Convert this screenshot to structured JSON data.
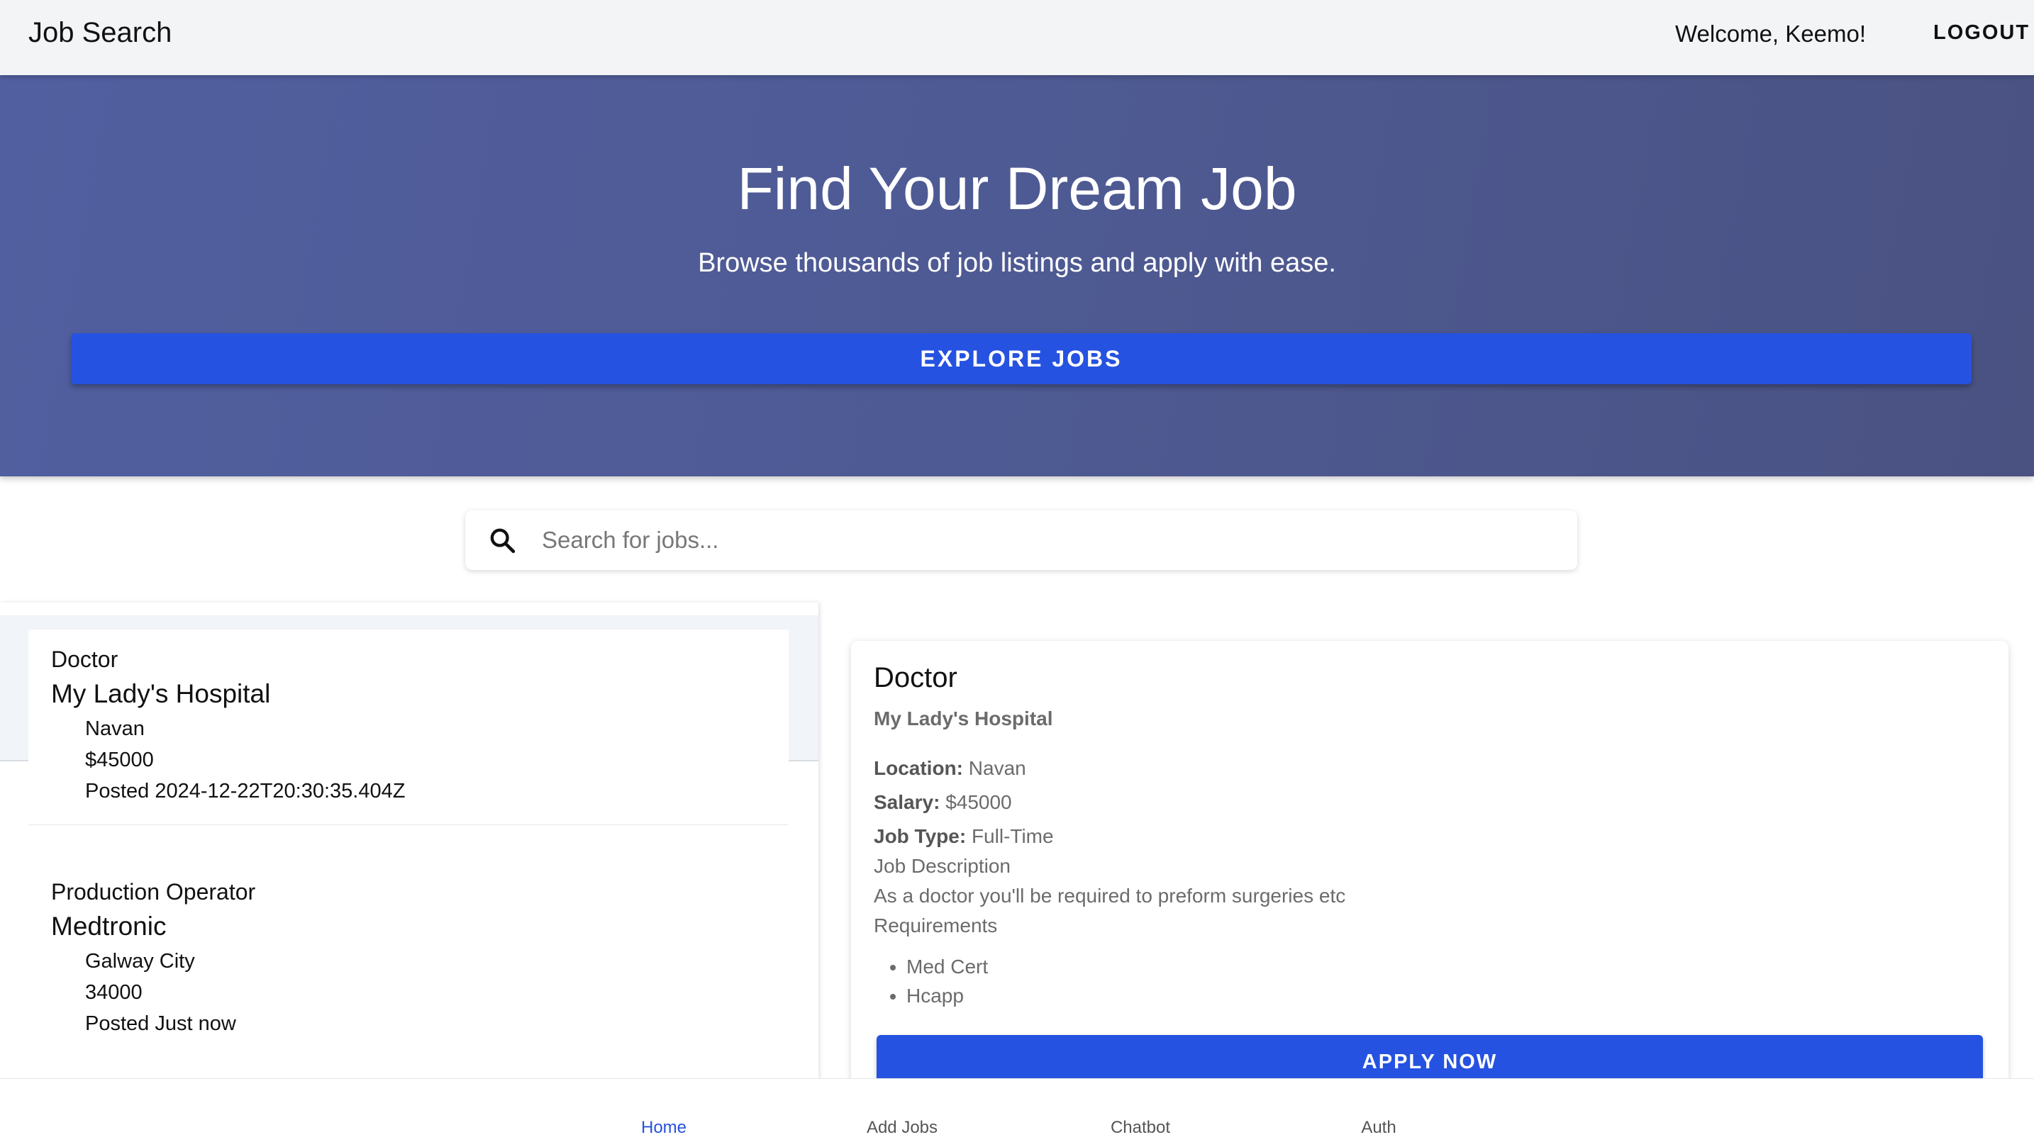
{
  "header": {
    "brand": "Job Search",
    "welcome": "Welcome, Keemo!",
    "logout_label": "LOGOUT"
  },
  "hero": {
    "title": "Find Your Dream Job",
    "subtitle": "Browse thousands of job listings and apply with ease.",
    "explore_label": "EXPLORE JOBS"
  },
  "search": {
    "placeholder": "Search for jobs...",
    "icon": "search-icon"
  },
  "jobs": [
    {
      "title": "Doctor",
      "company": "My Lady's Hospital",
      "location": "Navan",
      "salary": "$45000",
      "posted": "Posted 2024-12-22T20:30:35.404Z"
    },
    {
      "title": "Production Operator",
      "company": "Medtronic",
      "location": "Galway City",
      "salary": "34000",
      "posted": "Posted Just now"
    }
  ],
  "detail": {
    "title": "Doctor",
    "company": "My Lady's Hospital",
    "location_label": "Location:",
    "location": "Navan",
    "salary_label": "Salary:",
    "salary": "$45000",
    "type_label": "Job Type:",
    "type": "Full-Time",
    "description_heading": "Job Description",
    "description": "As a doctor you'll be required to preform surgeries etc",
    "requirements_heading": "Requirements",
    "requirements": [
      "Med Cert",
      "Hcapp"
    ],
    "apply_label": "APPLY NOW"
  },
  "nav": {
    "items": [
      {
        "label": "Home",
        "active": true
      },
      {
        "label": "Add Jobs",
        "active": false
      },
      {
        "label": "Chatbot",
        "active": false
      },
      {
        "label": "Auth",
        "active": false
      }
    ]
  },
  "colors": {
    "accent": "#2552e0",
    "hero_start": "#515fa0",
    "hero_end": "#4a5282",
    "topbar": "#f3f4f6"
  }
}
